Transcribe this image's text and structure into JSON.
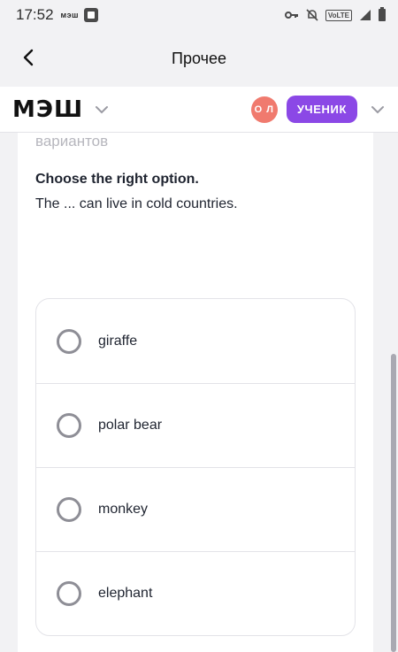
{
  "status_bar": {
    "time": "17:52",
    "app_label": "мэш",
    "volte": "VoLTE"
  },
  "title_bar": {
    "title": "Прочее"
  },
  "header": {
    "logo": "МЭШ",
    "avatar_initials": "О Л",
    "role": "УЧЕНИК",
    "colors": {
      "avatar": "#f07a6e",
      "role_badge": "#8b48e6"
    }
  },
  "question": {
    "cut_text": "вариантов",
    "title": "Choose the right option.",
    "text": "The ... can  live in cold countries.",
    "options": [
      {
        "label": "giraffe"
      },
      {
        "label": "polar bear"
      },
      {
        "label": "monkey"
      },
      {
        "label": "elephant"
      }
    ]
  }
}
